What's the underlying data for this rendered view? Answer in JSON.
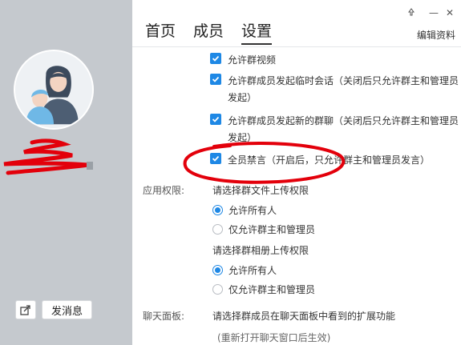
{
  "tabs": [
    {
      "label": "首页"
    },
    {
      "label": "成员"
    },
    {
      "label": "设置"
    }
  ],
  "header": {
    "edit_label": "编辑资料",
    "pin_icon": "pin-icon",
    "minimize_label": "—",
    "close_label": "✕"
  },
  "left": {
    "message_button": "发消息",
    "share_icon": "share-icon"
  },
  "permissions": {
    "items": [
      {
        "label": "允许群视频",
        "checked": true
      },
      {
        "label": "允许群成员发起临时会话（关闭后只允许群主和管理员发起）",
        "checked": true
      },
      {
        "label": "允许群成员发起新的群聊（关闭后只允许群主和管理员发起）",
        "checked": true
      },
      {
        "label": "全员禁言（开启后，只允许群主和管理员发言）",
        "checked": true
      }
    ]
  },
  "app_permissions": {
    "section_label": "应用权限:",
    "file_upload": {
      "label": "请选择群文件上传权限",
      "options": [
        {
          "label": "允许所有人",
          "checked": true
        },
        {
          "label": "仅允许群主和管理员",
          "checked": false
        }
      ]
    },
    "album_upload": {
      "label": "请选择群相册上传权限",
      "options": [
        {
          "label": "允许所有人",
          "checked": true
        },
        {
          "label": "仅允许群主和管理员",
          "checked": false
        }
      ]
    }
  },
  "chat_panel": {
    "section_label": "聊天面板:",
    "description": "请选择群成员在聊天面板中看到的扩展功能",
    "note": "(重新打开聊天窗口后生效)"
  },
  "colors": {
    "accent": "#1e88e5",
    "left_bg": "#c5c9ce",
    "annotation": "#e0000a"
  }
}
